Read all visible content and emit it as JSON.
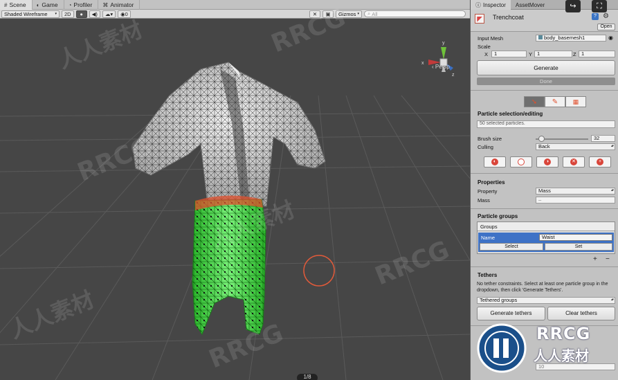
{
  "scene_tabs": [
    {
      "label": "Scene",
      "icon": "scene-icon"
    },
    {
      "label": "Game",
      "icon": "game-icon"
    },
    {
      "label": "Profiler",
      "icon": "profiler-icon"
    },
    {
      "label": "Animator",
      "icon": "animator-icon"
    }
  ],
  "toolbar": {
    "shading_mode": "Shaded Wireframe",
    "mode_2d": "2D",
    "fx_count": "0",
    "gizmos_label": "Gizmos",
    "search_placeholder": "All"
  },
  "viewport": {
    "persp_label": "‹ Persp",
    "page_indicator": "1/8",
    "colors": {
      "background": "#464646",
      "selected_particles": "#39e23a",
      "brush_ring": "#e05a3a"
    }
  },
  "inspector": {
    "tabs": [
      "Inspector",
      "AssetMover"
    ],
    "object_name": "Trenchcoat",
    "open_label": "Open",
    "input_mesh_label": "Input Mesh",
    "input_mesh_value": "body_basemesh1",
    "scale_label": "Scale",
    "scale": {
      "x_label": "X",
      "x": "1",
      "y_label": "Y",
      "y": "1",
      "z_label": "Z",
      "z": "1"
    },
    "generate_label": "Generate",
    "done_label": "Done",
    "particle_section_title": "Particle selection/editing",
    "selected_info": "50 selected particles.",
    "brush_size_label": "Brush size",
    "brush_size_value": "32",
    "brush_size_fraction": 0.1,
    "culling_label": "Culling",
    "culling_value": "Back",
    "properties_title": "Properties",
    "property_label": "Property",
    "property_value": "Mass",
    "mass_label": "Mass",
    "mass_value": "–",
    "particle_groups_title": "Particle groups",
    "groups_label": "Groups",
    "group_name_label": "Name",
    "group_name_value": "Waist",
    "group_select_label": "Select",
    "group_set_label": "Set",
    "add_label": "+",
    "remove_label": "−",
    "tethers_title": "Tethers",
    "tethers_message": "No tether constraints. Select at least one particle group in the dropdown, then click 'Generate Tethers'.",
    "tethered_groups_value": "Tethered groups",
    "generate_tethers_label": "Generate tethers",
    "clear_tethers_label": "Clear tethers",
    "bottom_value": "10"
  },
  "watermark": {
    "text": "RRCG",
    "cn_text": "人人素材",
    "brand_name": "RRCG",
    "brand_sub": "人人素材"
  }
}
